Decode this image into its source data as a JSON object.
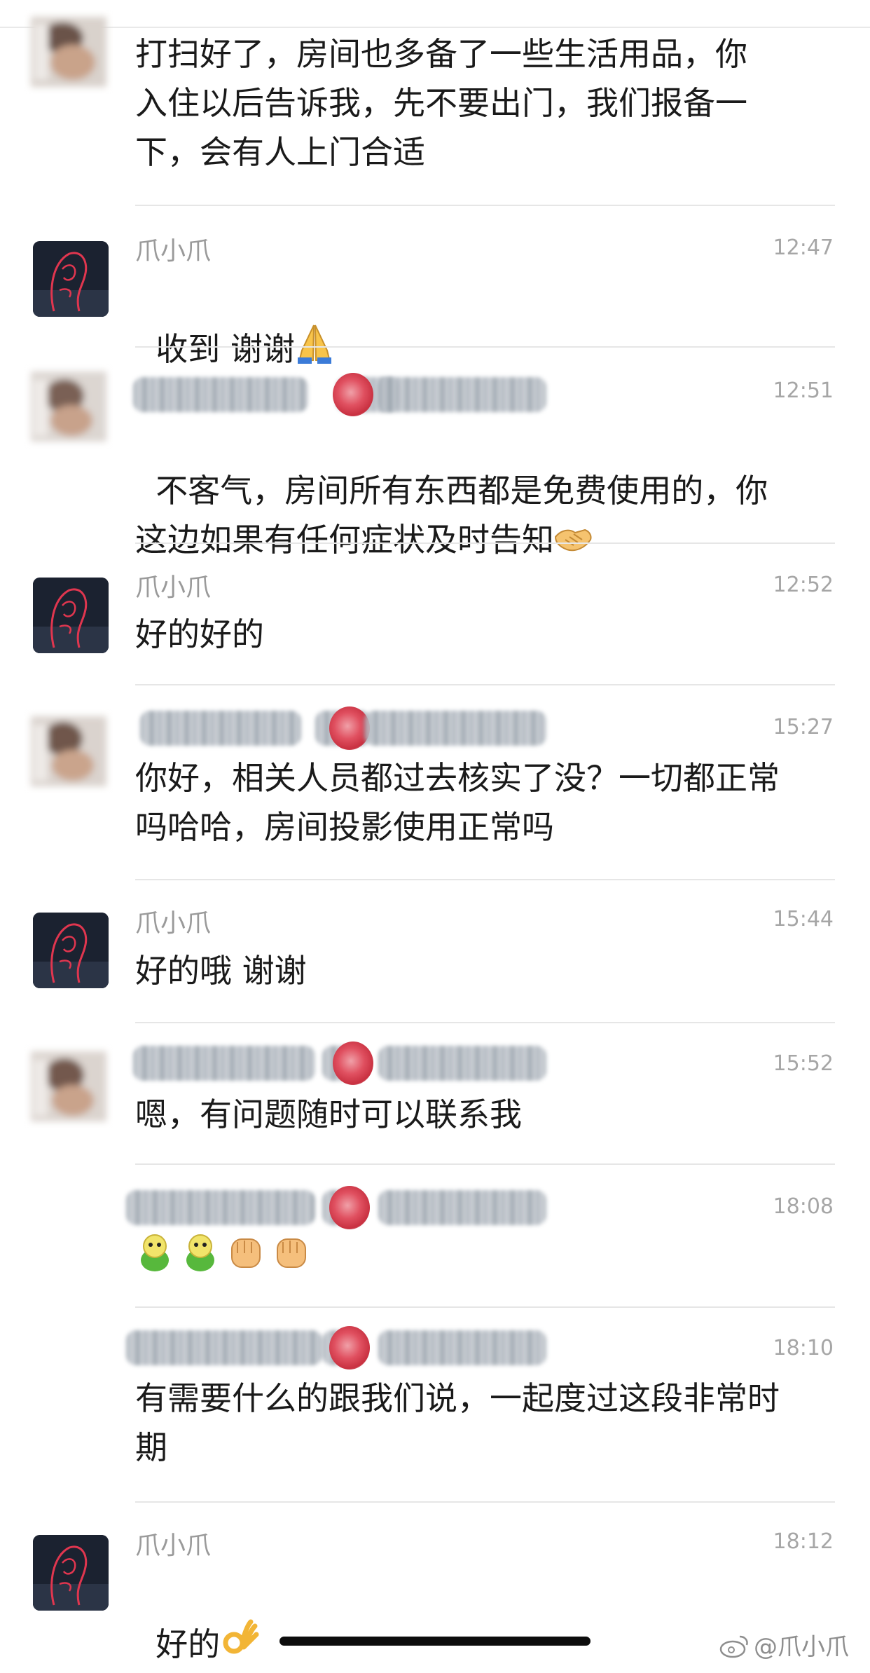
{
  "messages": [
    {
      "sender_type": "other",
      "name": "",
      "time": "",
      "text": "打扫好了，房间也多备了一些生活用品，你\n入住以后告诉我，先不要出门，我们报备一\n下，会有人上门合适"
    },
    {
      "sender_type": "me",
      "name": "爪小爪",
      "time": "12:47",
      "text": "收到 谢谢",
      "emoji": "folded-hands-emoji"
    },
    {
      "sender_type": "other",
      "name": "",
      "time": "12:51",
      "text": "不客气，房间所有东西都是免费使用的，你\n这边如果有任何症状及时告知",
      "emoji": "handshake-emoji"
    },
    {
      "sender_type": "me",
      "name": "爪小爪",
      "time": "12:52",
      "text": "好的好的"
    },
    {
      "sender_type": "other",
      "name": "",
      "time": "15:27",
      "text": "你好，相关人员都过去核实了没？一切都正常\n吗哈哈，房间投影使用正常吗"
    },
    {
      "sender_type": "me",
      "name": "爪小爪",
      "time": "15:44",
      "text": "好的哦 谢谢"
    },
    {
      "sender_type": "other",
      "name": "",
      "time": "15:52",
      "text": "嗯，有问题随时可以联系我"
    },
    {
      "sender_type": "other",
      "name": "",
      "time": "18:08",
      "text": "",
      "emojis": [
        "green-guy-emoji",
        "green-guy-emoji",
        "fist-emoji",
        "fist-emoji"
      ]
    },
    {
      "sender_type": "other",
      "name": "",
      "time": "18:10",
      "text": "有需要什么的跟我们说，一起度过这段非常时\n期"
    },
    {
      "sender_type": "me",
      "name": "爪小爪",
      "time": "18:12",
      "text": "好的",
      "emoji": "ok-hand-emoji"
    }
  ],
  "watermark": {
    "text": "@爪小爪",
    "icon": "weibo-icon"
  },
  "colors": {
    "rose": "#d8404f",
    "avatar_bg": "#1b2230",
    "neon": "#e0364f"
  }
}
